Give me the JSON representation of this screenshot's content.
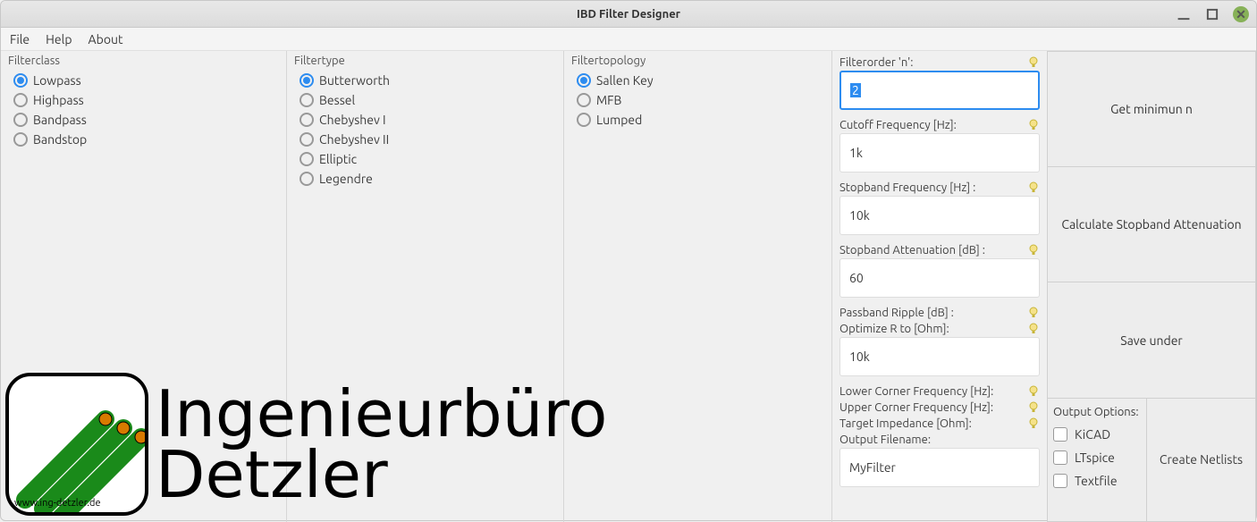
{
  "window": {
    "title": "IBD Filter Designer"
  },
  "menu": {
    "file": "File",
    "help": "Help",
    "about": "About"
  },
  "columns": {
    "filterclass": {
      "header": "Filterclass",
      "items": [
        "Lowpass",
        "Highpass",
        "Bandpass",
        "Bandstop"
      ],
      "selected": 0
    },
    "filtertype": {
      "header": "Filtertype",
      "items": [
        "Butterworth",
        "Bessel",
        "Chebyshev I",
        "Chebyshev II",
        "Elliptic",
        "Legendre"
      ],
      "selected": 0
    },
    "filtertopology": {
      "header": "Filtertopology",
      "items": [
        "Sallen Key",
        "MFB",
        "Lumped"
      ],
      "selected": 0
    }
  },
  "params": {
    "order_label": "Filterorder 'n':",
    "order_value": "2",
    "cutoff_label": "Cutoff Frequency [Hz]:",
    "cutoff_value": "1k",
    "stopfreq_label": "Stopband Frequency [Hz] :",
    "stopfreq_value": "10k",
    "stopatt_label": "Stopband Attenuation [dB] :",
    "stopatt_value": "60",
    "ripple_label": "Passband Ripple [dB] :",
    "optr_label": "Optimize R to [Ohm]:",
    "optr_value": "10k",
    "lowcorner_label": "Lower Corner Frequency [Hz]:",
    "upcorner_label": "Upper Corner Frequency [Hz]:",
    "targetimp_label": "Target Impedance [Ohm]:",
    "outfile_label": "Output Filename:",
    "outfile_value": "MyFilter"
  },
  "output_options": {
    "header": "Output Options:",
    "items": [
      "KiCAD",
      "LTspice",
      "Textfile"
    ]
  },
  "actions": {
    "get_min_n": "Get minimun n",
    "calc_stop": "Calculate Stopband Attenuation",
    "save_under": "Save under",
    "create_netlists": "Create Netlists"
  },
  "logo": {
    "line1": "Ingenieurbüro",
    "line2": "Detzler",
    "url": "www.ing-detzler.de"
  }
}
